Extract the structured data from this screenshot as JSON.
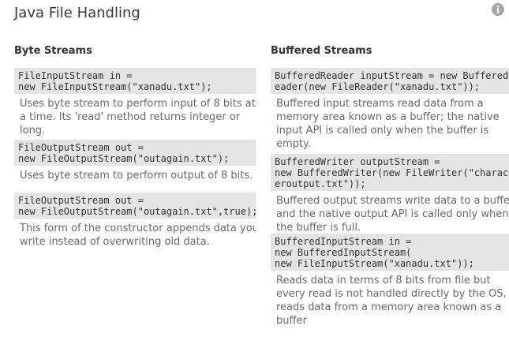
{
  "header": {
    "title": "Java File Handling",
    "info_icon": "info-circle-icon"
  },
  "byte_streams": {
    "heading": "Byte Streams",
    "entries": [
      {
        "code": "FileInputStream in =\nnew FileInputStream(\"xanadu.txt\");",
        "description": "Uses byte stream to perform input of 8 bits at\na time. Its 'read' method returns integer or\nlong."
      },
      {
        "code": "FileOutputStream out =\nnew FileOutputStream(\"outagain.txt\");",
        "description": "Uses byte stream to perform output of 8 bits."
      },
      {
        "code": "FileOutputStream out =\nnew FileOutputStream(\"outagain.txt\",true);",
        "description": "This form of the constructor appends data you\nwrite instead of overwriting old data."
      }
    ]
  },
  "buffered_streams": {
    "heading": "Buffered Streams",
    "entries": [
      {
        "code": "BufferedReader inputStream = new BufferedR\neader(new FileReader(\"xanadu.txt\"));",
        "description": "Buffered input streams read data from a\nmemory area known as a buffer; the native\ninput API is called only when the buffer is\nempty."
      },
      {
        "code": "BufferedWriter outputStream =\nnew BufferedWriter(new FileWriter(\"charact\neroutput.txt\"));",
        "description": "Buffered output streams write data to a buffer,\nand the native output API is called only when\nthe buffer is full."
      },
      {
        "code": "BufferedInputStream in =\nnew BufferedInputStream(\nnew FileInputStream(\"xanadu.txt\"));",
        "description": "Reads data in terms of 8 bits from file but\nevery read is not handled directly by the OS, it\nreads data from a memory area known as a\nbuffer"
      }
    ]
  },
  "colors": {
    "code_background": "#e4e4e4",
    "description_text": "#6a6a6a",
    "icon": "#a6a6a6"
  }
}
